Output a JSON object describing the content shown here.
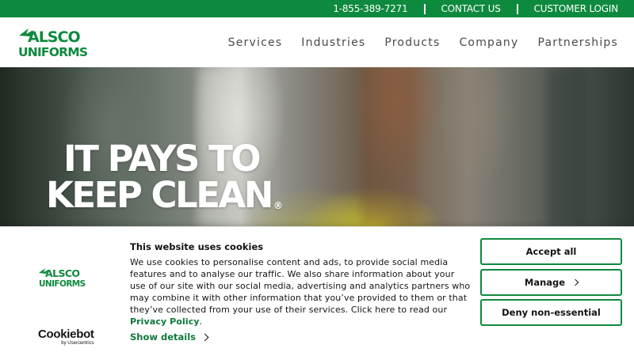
{
  "topbar": {
    "phone": "1-855-389-7271",
    "contact": "CONTACT US",
    "login": "CUSTOMER LOGIN"
  },
  "brand": {
    "logo_line1": "ALSCO",
    "logo_line2": "UNIFORMS",
    "color": "#0e8a3e"
  },
  "nav": {
    "items": [
      "Services",
      "Industries",
      "Products",
      "Company",
      "Partnerships"
    ]
  },
  "hero": {
    "title_line1": "IT PAYS TO",
    "title_line2": "KEEP CLEAN",
    "trademark": "®"
  },
  "cookie_banner": {
    "title": "This website uses cookies",
    "body": "We use cookies to personalise content and ads, to provide social media features and to analyse our traffic. We also share information about your use of our site with our social media, advertising and analytics partners who may combine it with other information that you’ve provided to them or that they’ve collected from your use of their services. Click here to read our ",
    "policy_link": "Privacy Policy",
    "body_end": ".",
    "show_details": "Show details",
    "accept_all": "Accept all",
    "manage": "Manage",
    "deny": "Deny non-essential",
    "provider_name": "Cookiebot",
    "provider_by": "by Usercentrics",
    "icons": [
      "chevron-right-icon"
    ]
  }
}
